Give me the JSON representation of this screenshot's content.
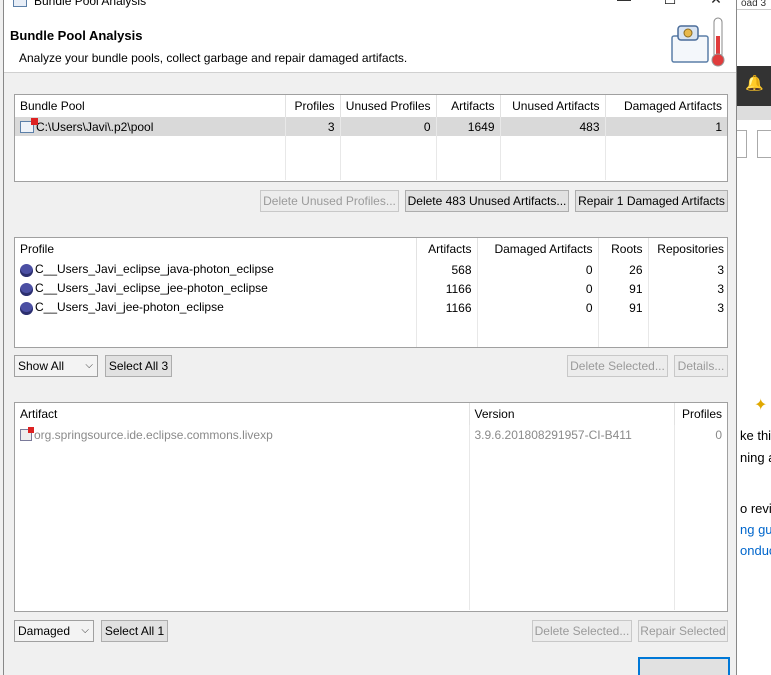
{
  "window": {
    "title": "Bundle Pool Analysis",
    "minimize": "—",
    "maximize": "☐",
    "close": "✕"
  },
  "banner": {
    "title": "Bundle Pool Analysis",
    "description": "Analyze your bundle pools, collect garbage and repair damaged artifacts."
  },
  "pools": {
    "headers": [
      "Bundle Pool",
      "Profiles",
      "Unused Profiles",
      "Artifacts",
      "Unused Artifacts",
      "Damaged Artifacts"
    ],
    "rows": [
      {
        "pool": "C:\\Users\\Javi\\.p2\\pool",
        "profiles": "3",
        "unused_profiles": "0",
        "artifacts": "1649",
        "unused_artifacts": "483",
        "damaged_artifacts": "1"
      }
    ],
    "buttons": {
      "delete_unused_profiles": "Delete Unused Profiles...",
      "delete_unused_artifacts": "Delete 483 Unused Artifacts...",
      "repair_damaged": "Repair 1 Damaged Artifacts"
    }
  },
  "profiles": {
    "headers": [
      "Profile",
      "Artifacts",
      "Damaged Artifacts",
      "Roots",
      "Repositories"
    ],
    "rows": [
      {
        "profile": "C__Users_Javi_eclipse_java-photon_eclipse",
        "artifacts": "568",
        "damaged": "0",
        "roots": "26",
        "repositories": "3"
      },
      {
        "profile": "C__Users_Javi_eclipse_jee-photon_eclipse",
        "artifacts": "1166",
        "damaged": "0",
        "roots": "91",
        "repositories": "3"
      },
      {
        "profile": "C__Users_Javi_jee-photon_eclipse",
        "artifacts": "1166",
        "damaged": "0",
        "roots": "91",
        "repositories": "3"
      }
    ],
    "filter": "Show All",
    "select_all": "Select All 3",
    "delete_selected": "Delete Selected...",
    "details": "Details..."
  },
  "artifacts": {
    "headers": [
      "Artifact",
      "Version",
      "Profiles"
    ],
    "rows": [
      {
        "artifact": "org.springsource.ide.eclipse.commons.livexp",
        "version": "3.9.6.201808291957-CI-B411",
        "profiles": "0"
      }
    ],
    "filter": "Damaged",
    "select_all": "Select All 1",
    "delete_selected": "Delete Selected...",
    "repair_selected": "Repair Selected"
  },
  "background": {
    "tab_text": "oad 3",
    "lines": [
      "ke this",
      "ning a",
      "o revie",
      "ng gu",
      "onduc"
    ]
  }
}
